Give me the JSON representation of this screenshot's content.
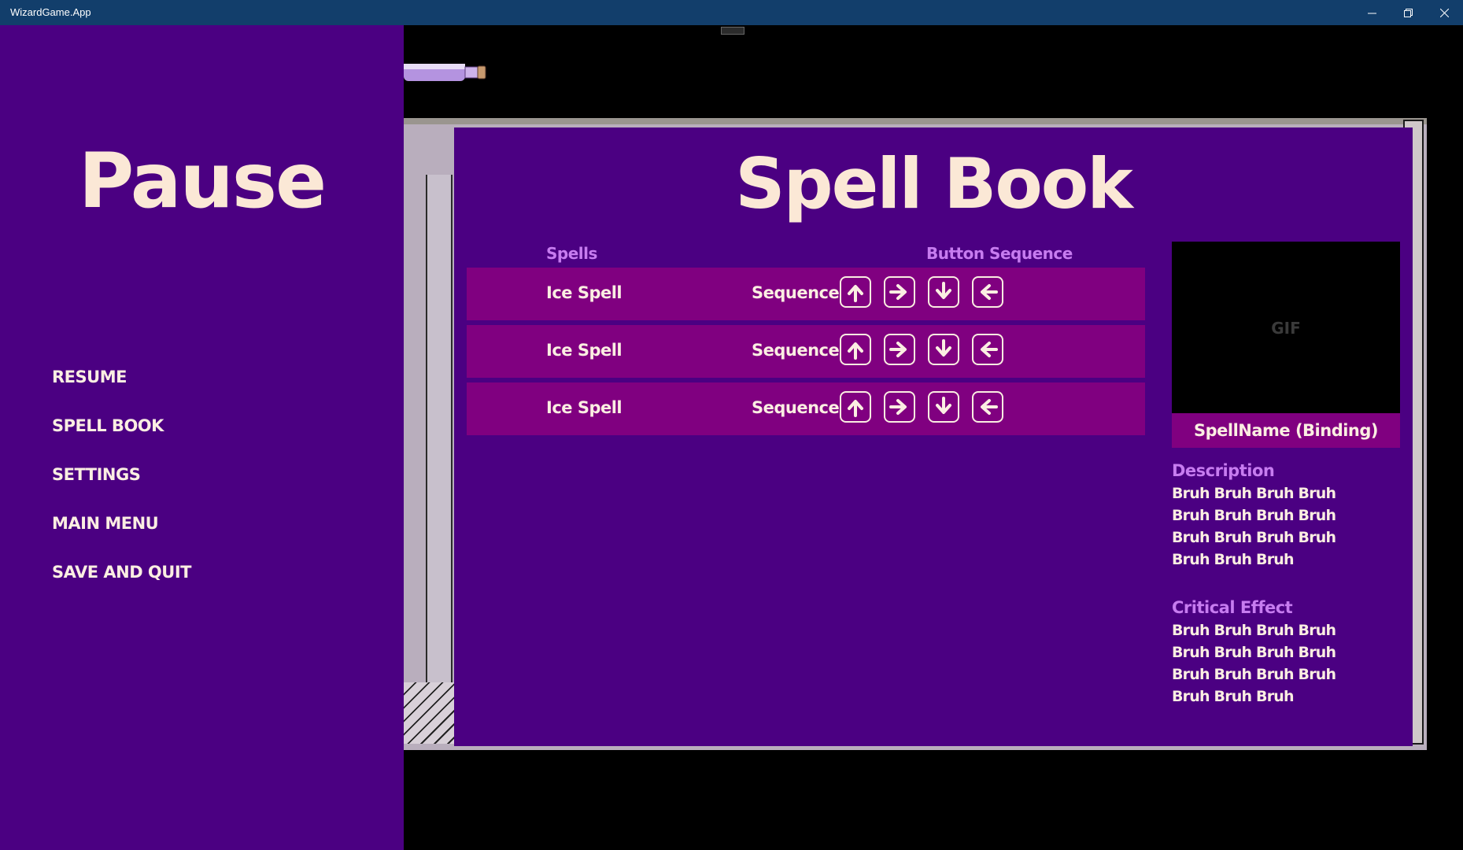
{
  "window": {
    "title": "WizardGame.App",
    "minimize_icon": "minimize-icon",
    "restore_icon": "restore-icon",
    "close_icon": "close-icon"
  },
  "pause": {
    "title": "Pause",
    "menu": [
      {
        "label": "RESUME"
      },
      {
        "label": "SPELL BOOK"
      },
      {
        "label": "SETTINGS"
      },
      {
        "label": "MAIN MENU"
      },
      {
        "label": "SAVE AND QUIT"
      }
    ]
  },
  "spellbook": {
    "title": "Spell Book",
    "headers": {
      "spells": "Spells",
      "sequence": "Button Sequence"
    },
    "rows": [
      {
        "name": "Ice Spell",
        "sequence_label": "Sequence",
        "arrows": [
          "up",
          "right",
          "down",
          "left"
        ]
      },
      {
        "name": "Ice Spell",
        "sequence_label": "Sequence",
        "arrows": [
          "up",
          "right",
          "down",
          "left"
        ]
      },
      {
        "name": "Ice Spell",
        "sequence_label": "Sequence",
        "arrows": [
          "up",
          "right",
          "down",
          "left"
        ]
      }
    ],
    "detail": {
      "gif_label": "GIF",
      "spell_name": "SpellName (Binding)",
      "description_heading": "Description",
      "description_text": "Bruh Bruh Bruh Bruh Bruh Bruh Bruh Bruh Bruh Bruh Bruh Bruh Bruh Bruh Bruh",
      "critical_heading": "Critical Effect",
      "critical_text": "Bruh Bruh Bruh Bruh Bruh Bruh Bruh Bruh Bruh Bruh Bruh Bruh Bruh Bruh Bruh"
    }
  },
  "colors": {
    "titlebar": "#123e6b",
    "panel_purple": "#4b0082",
    "row_magenta": "#800080",
    "heading_lilac": "#c77cf0",
    "text_cream": "#fbeee2"
  }
}
